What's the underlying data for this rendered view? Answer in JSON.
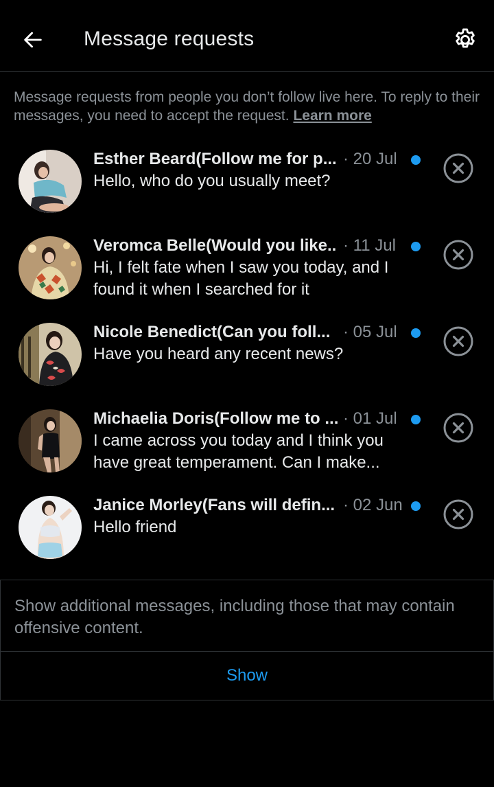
{
  "header": {
    "title": "Message requests",
    "back_icon": "arrow-left-icon",
    "settings_icon": "gear-icon"
  },
  "info": {
    "text": "Message requests from people you don’t follow live here. To reply to their messages, you need to accept the request.",
    "link": "Learn more"
  },
  "requests": [
    {
      "name": "Esther Beard(Follow me for p...",
      "date": "· 20 Jul",
      "message": "Hello, who do you usually meet?",
      "unread": true
    },
    {
      "name": "Veromca Belle(Would you like...",
      "date": "· 11 Jul",
      "message": "Hi, I felt fate when I saw you today, and I found it when I searched for it",
      "unread": true
    },
    {
      "name": "Nicole Benedict(Can you foll...",
      "date": "· 05 Jul",
      "message": "Have you heard any recent news?",
      "unread": true
    },
    {
      "name": "Michaelia Doris(Follow me to ...",
      "date": "· 01 Jul",
      "message": "I came across you today and I think you have great temperament. Can I make...",
      "unread": true
    },
    {
      "name": "Janice Morley(Fans will defin...",
      "date": "· 02 Jun",
      "message": "Hello friend",
      "unread": true
    }
  ],
  "additional": {
    "text": "Show additional messages, including those that may contain offensive content.",
    "show_label": "Show"
  },
  "colors": {
    "accent": "#1d9bf0",
    "background": "#000000",
    "muted_text": "#8b9197",
    "border": "#2f3336"
  }
}
